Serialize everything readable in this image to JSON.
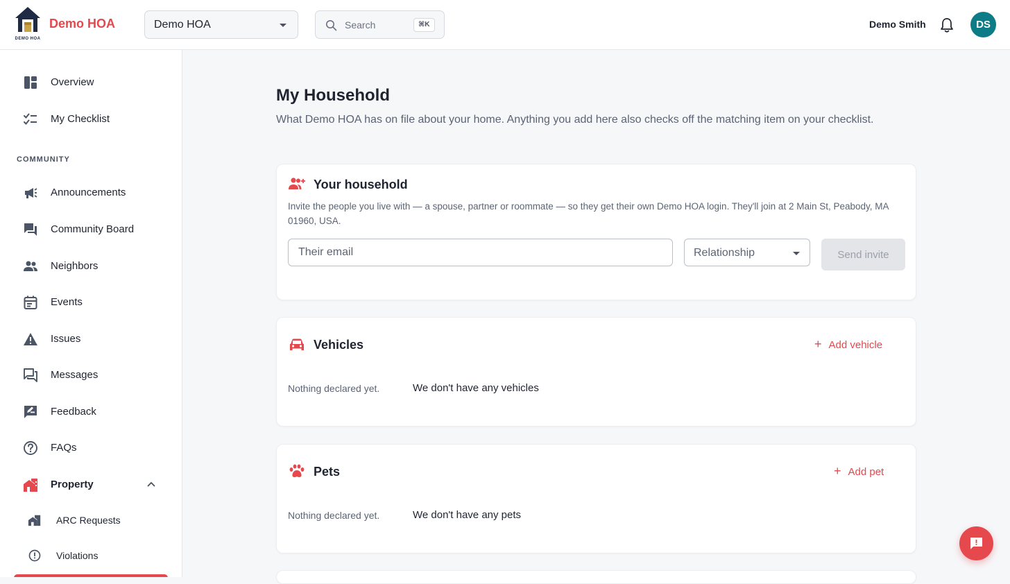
{
  "header": {
    "logo_caption": "DEMO HOA",
    "brand": "Demo HOA",
    "org_select": {
      "value": "Demo HOA"
    },
    "search": {
      "placeholder": "Search",
      "shortcut": "⌘K"
    },
    "user_name": "Demo Smith",
    "avatar_initials": "DS"
  },
  "sidebar": {
    "items": [
      {
        "label": "Overview",
        "icon": "dashboard-icon"
      },
      {
        "label": "My Checklist",
        "icon": "checklist-icon"
      }
    ],
    "section_label": "COMMUNITY",
    "community_items": [
      {
        "label": "Announcements",
        "icon": "megaphone-icon"
      },
      {
        "label": "Community Board",
        "icon": "forum-icon"
      },
      {
        "label": "Neighbors",
        "icon": "people-icon"
      },
      {
        "label": "Events",
        "icon": "calendar-icon"
      },
      {
        "label": "Issues",
        "icon": "warning-icon"
      },
      {
        "label": "Messages",
        "icon": "messages-icon"
      },
      {
        "label": "Feedback",
        "icon": "feedback-icon"
      },
      {
        "label": "FAQs",
        "icon": "help-icon"
      },
      {
        "label": "Property",
        "icon": "property-icon",
        "expanded": true
      }
    ],
    "property_subitems": [
      {
        "label": "ARC Requests",
        "icon": "arc-icon"
      },
      {
        "label": "Violations",
        "icon": "alert-circle-icon"
      }
    ]
  },
  "main": {
    "title": "My Household",
    "subtitle": "What Demo HOA has on file about your home. Anything you add here also checks off the matching item on your checklist.",
    "household": {
      "title": "Your household",
      "description": "Invite the people you live with — a spouse, partner or roommate — so they get their own Demo HOA login. They'll join at 2 Main St, Peabody, MA 01960, USA.",
      "email_placeholder": "Their email",
      "relationship_placeholder": "Relationship",
      "send_label": "Send invite"
    },
    "vehicles": {
      "title": "Vehicles",
      "add_label": "Add vehicle",
      "empty_label": "Nothing declared yet.",
      "empty_value": "We don't have any vehicles"
    },
    "pets": {
      "title": "Pets",
      "add_label": "Add pet",
      "empty_label": "Nothing declared yet.",
      "empty_value": "We don't have any pets"
    }
  },
  "colors": {
    "accent": "#e5484d",
    "avatar": "#0e7c86",
    "navy": "#1f2a44"
  }
}
